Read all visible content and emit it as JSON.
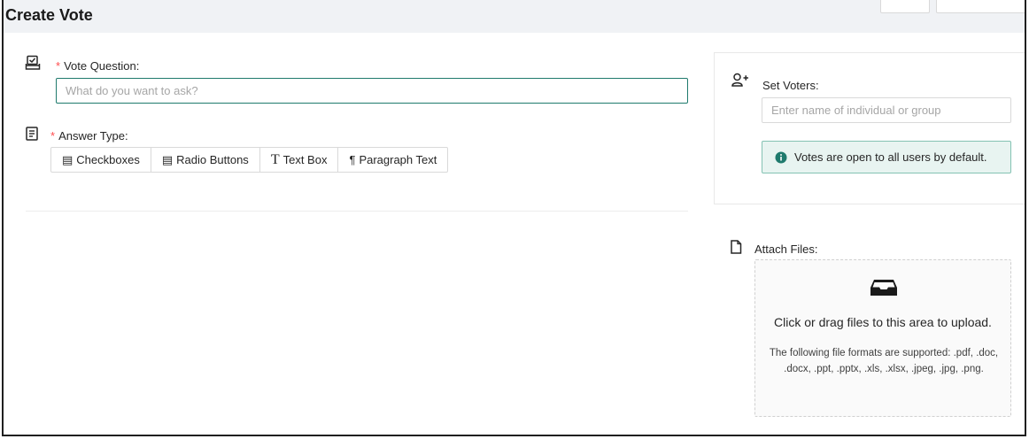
{
  "page": {
    "title": "Create Vote"
  },
  "question": {
    "label": "Vote Question",
    "required_mark": "*",
    "placeholder": "What do you want to ask?"
  },
  "answer_type": {
    "label": "Answer Type",
    "required_mark": "*",
    "options": [
      {
        "label": "Checkboxes",
        "icon": "list-icon"
      },
      {
        "label": "Radio Buttons",
        "icon": "list-icon"
      },
      {
        "label": "Text Box",
        "icon": "text-t-icon"
      },
      {
        "label": "Paragraph Text",
        "icon": "pilcrow-icon"
      }
    ]
  },
  "voters": {
    "label": "Set Voters",
    "placeholder": "Enter name of individual or group",
    "info": "Votes are open to all users by default."
  },
  "attach": {
    "label": "Attach Files",
    "drop_text": "Click or drag files to this area to upload.",
    "hint": "The following file formats are supported: .pdf, .doc, .docx, .ppt, .pptx, .xls, .xlsx, .jpeg, .jpg, .png."
  },
  "colors": {
    "accent": "#1f7a6d",
    "required": "#ff4d4f",
    "info_bg": "#e8f4f1",
    "info_border": "#84c2b3"
  }
}
